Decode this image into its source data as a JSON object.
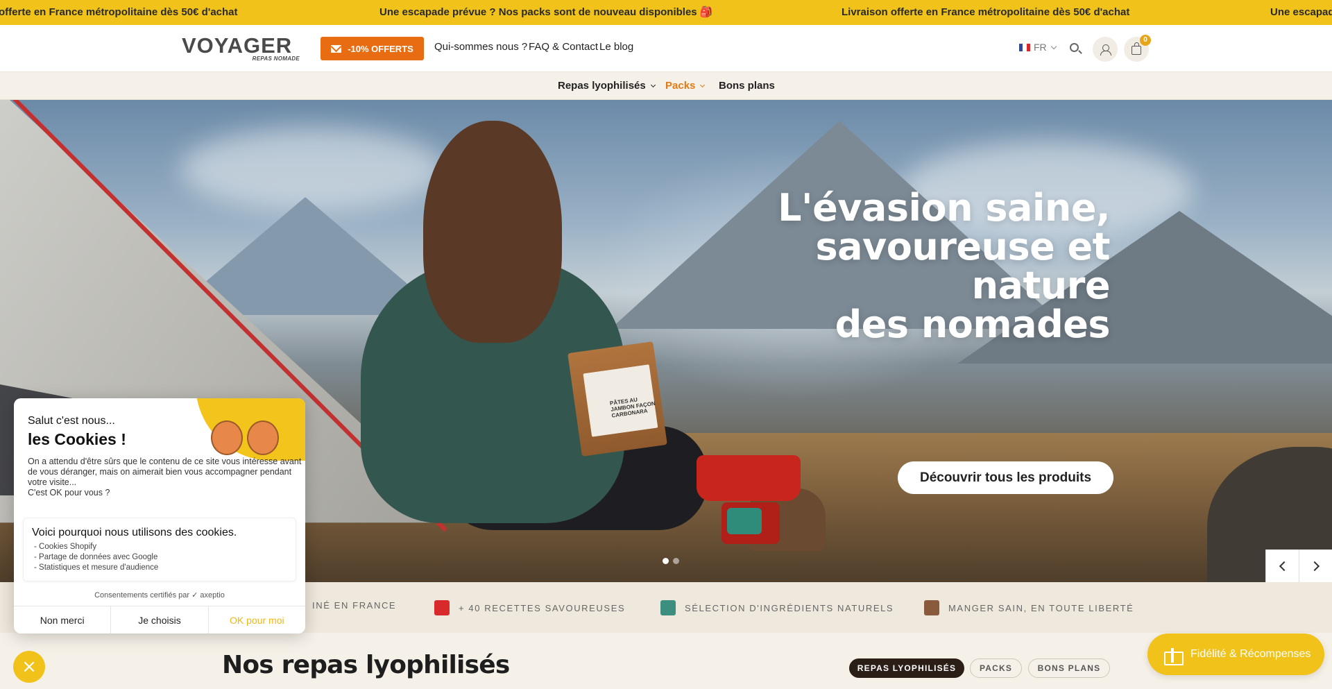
{
  "announcement": {
    "messages": [
      "offerte en France métropolitaine dès 50€ d'achat",
      "Une escapade prévue ? Nos packs sont de nouveau disponibles 🎒",
      "Livraison offerte en France métropolitaine dès 50€ d'achat",
      "Une escapade"
    ]
  },
  "header": {
    "logo": "VOYAGER",
    "logo_tagline": "REPAS NOMADE",
    "promo_label": "-10% OFFERTS",
    "nav": [
      "Qui-sommes nous ?",
      "FAQ & Contact",
      "Le blog"
    ],
    "lang": "FR",
    "cart_count": "0"
  },
  "subnav": {
    "items": [
      "Repas lyophilisés",
      "Packs",
      "Bons plans"
    ],
    "active": "Packs"
  },
  "hero": {
    "title_lines": [
      "L'évasion saine,",
      "savoureuse et",
      "nature",
      "des nomades"
    ],
    "cta": "Découvrir tous les produits",
    "pouch_text": "PÂTES AU JAMBON FAÇON CARBONARA",
    "slides": 2,
    "active_slide": 1
  },
  "features": [
    {
      "label": "INÉ EN FRANCE"
    },
    {
      "label": "+ 40 RECETTES SAVOUREUSES"
    },
    {
      "label": "SÉLECTION D'INGRÉDIENTS NATURELS"
    },
    {
      "label": "MANGER SAIN, EN TOUTE LIBERTÉ"
    }
  ],
  "section": {
    "title": "Nos repas lyophilisés",
    "filters": [
      "REPAS LYOPHILISÉS",
      "PACKS",
      "BONS PLANS"
    ],
    "active_filter": "REPAS LYOPHILISÉS"
  },
  "loyalty": {
    "label": "Fidélité & Récompenses"
  },
  "cookie": {
    "greeting": "Salut c'est nous...",
    "title": "les Cookies !",
    "body": "On a attendu d'être sûrs que le contenu de ce site vous intéresse avant de vous déranger, mais on aimerait bien vous accompagner pendant votre visite...",
    "question": "C'est OK pour vous ?",
    "why_title": "Voici pourquoi nous utilisons des cookies.",
    "reasons": [
      "- Cookies Shopify",
      "- Partage de données avec Google",
      "- Statistiques et mesure d'audience"
    ],
    "certified": "Consentements certifiés par ✓ axeptio",
    "buttons": [
      "Non merci",
      "Je choisis",
      "OK pour moi"
    ],
    "close": "×"
  },
  "colors": {
    "accent_yellow": "#f0c21a",
    "accent_orange": "#e86d12",
    "dark_brown": "#2a1e16",
    "cream": "#f6f1e8"
  },
  "icons": [
    "mail-icon",
    "flag-fr-icon",
    "search-icon",
    "user-icon",
    "cart-icon",
    "chevron-down-icon",
    "arrow-left-icon",
    "arrow-right-icon",
    "gift-icon",
    "close-icon"
  ]
}
